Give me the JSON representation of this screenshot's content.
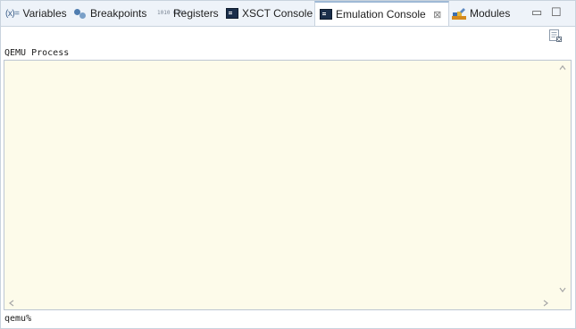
{
  "tabs": [
    {
      "label": "Variables",
      "icon": "variables-icon",
      "icon_text": "(x)="
    },
    {
      "label": "Breakpoints",
      "icon": "breakpoints-icon"
    },
    {
      "label": "Registers",
      "icon": "registers-icon",
      "icon_text": "1010 0101"
    },
    {
      "label": "XSCT Console",
      "icon": "console-icon"
    },
    {
      "label": "Emulation Console",
      "icon": "console-icon",
      "active": true,
      "close_glyph": "⊠"
    },
    {
      "label": "Modules",
      "icon": "modules-icon"
    }
  ],
  "window_controls": {
    "minimize": "▭",
    "maximize": "☐"
  },
  "console": {
    "process_label": "QEMU Process",
    "prompt": "qemu%",
    "background": "#fdfbea"
  },
  "colors": {
    "accent": "#9fb9d6",
    "tabbar_bg": "#eef3f9"
  }
}
